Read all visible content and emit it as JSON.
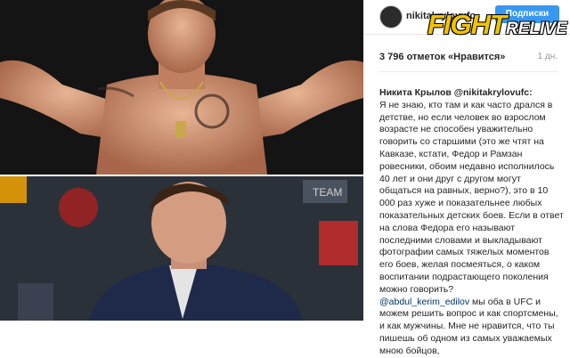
{
  "post": {
    "username": "nikitakrylovufc",
    "follow_label": "Подписки",
    "brand_main": "FIGHT",
    "brand_suffix": "RELIVE",
    "likes": "3 796 отметок «Нравится»",
    "time": "1 дн.",
    "caption_author": "Никита Крылов @nikitakrylovufc:",
    "caption_part1": "Я не знаю, кто там и как часто дрался в детстве, но если человек во взрослом возрасте не способен уважительно говорить со старшими (это же чтят на Кавказе, кстати, Федор и Рамзан ровесники, обоим недавно исполнилось 40 лет и они друг с другом могут общаться на равных, верно?), это в 10 000 раз хуже и показательнее любых показательных детских боев. Если в ответ на слова Федора его называют последними словами и выкладывают фотографии самых тяжелых моментов его боев, желая посмеяться, о каком воспитании подрастающего поколения можно говорить?",
    "caption_mention": "@abdul_kerim_edilov",
    "caption_part2": " мы оба в UFC и можем решить вопрос и как спортсмены, и как мужчины. Мне не нравится, что ты пишешь об одном из самых уважаемых мною бойцов,"
  },
  "photos": {
    "top_label": "Krylov weigh-in photo",
    "bottom_label": "Edilov press photo",
    "banner_text": "TEAM"
  },
  "colors": {
    "follow": "#3897f0",
    "brand": "#f2c400"
  }
}
